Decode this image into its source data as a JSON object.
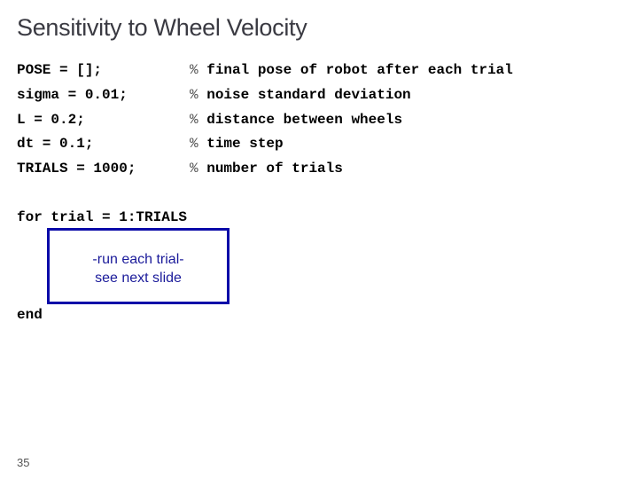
{
  "slide": {
    "title": "Sensitivity to Wheel Velocity",
    "page_number": "35"
  },
  "code": {
    "declarations": [
      {
        "statement": "POSE = [];",
        "comment_marker": "%",
        "comment": "final pose of robot after each trial"
      },
      {
        "statement": "sigma = 0.01;",
        "comment_marker": "%",
        "comment": "noise standard deviation"
      },
      {
        "statement": "L = 0.2;",
        "comment_marker": "%",
        "comment": "distance between wheels"
      },
      {
        "statement": "dt = 0.1;",
        "comment_marker": "%",
        "comment": "time step"
      },
      {
        "statement": "TRIALS = 1000;",
        "comment_marker": "%",
        "comment": "number of trials"
      }
    ],
    "loop_start": "for trial = 1:TRIALS",
    "loop_end": "end"
  },
  "placeholder_box": {
    "line1": "-run each trial-",
    "line2": "see next slide",
    "border_color": "#0a0aa8",
    "text_color": "#1a1a9a"
  }
}
